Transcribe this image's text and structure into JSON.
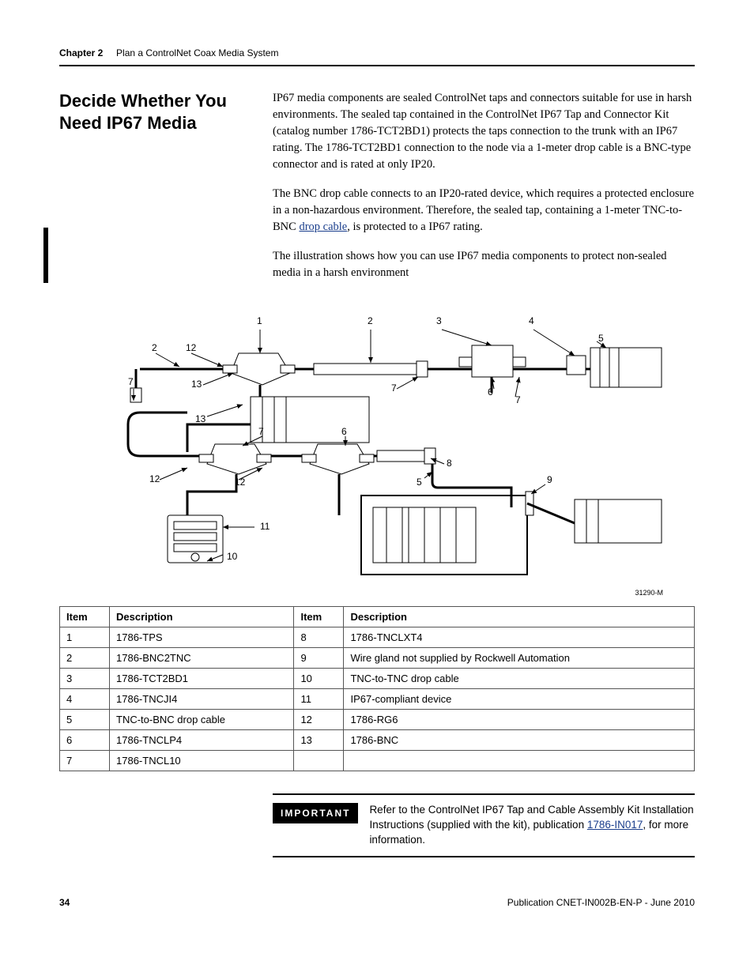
{
  "header": {
    "chapter_label": "Chapter 2",
    "chapter_title": "Plan a ControlNet Coax Media System"
  },
  "section_heading": "Decide Whether You Need IP67 Media",
  "paragraphs": {
    "p1": "IP67 media components are sealed ControlNet taps and connectors suitable for use in harsh environments. The sealed tap contained in the ControlNet IP67 Tap and Connector Kit (catalog number 1786-TCT2BD1) protects the taps connection to the trunk with an IP67 rating. The 1786-TCT2BD1 connection to the node via a 1-meter drop cable is a BNC-type connector and is rated at only IP20.",
    "p2a": "The BNC drop cable connects to an IP20-rated device, which requires a protected enclosure in a non-hazardous environment. Therefore, the sealed tap, containing a 1-meter TNC-to-BNC ",
    "p2_link": "drop cable",
    "p2b": ", is protected to a IP67 rating.",
    "p3": "The illustration shows how you can use IP67 media components to protect non-sealed media in a harsh environment"
  },
  "diagram": {
    "labels": {
      "n1": "1",
      "n2": "2",
      "n3": "3",
      "n4": "4",
      "n5": "5",
      "n6": "6",
      "n7": "7",
      "n8": "8",
      "n9": "9",
      "n10": "10",
      "n11": "11",
      "n12": "12",
      "n13": "13"
    },
    "fig_code": "31290-M"
  },
  "table": {
    "headers": {
      "item": "Item",
      "desc": "Description"
    },
    "left": [
      {
        "item": "1",
        "desc": "1786-TPS"
      },
      {
        "item": "2",
        "desc": "1786-BNC2TNC"
      },
      {
        "item": "3",
        "desc": "1786-TCT2BD1"
      },
      {
        "item": "4",
        "desc": "1786-TNCJI4"
      },
      {
        "item": "5",
        "desc": "TNC-to-BNC drop cable"
      },
      {
        "item": "6",
        "desc": "1786-TNCLP4"
      },
      {
        "item": "7",
        "desc": "1786-TNCL10"
      }
    ],
    "right": [
      {
        "item": "8",
        "desc": "1786-TNCLXT4"
      },
      {
        "item": "9",
        "desc": "Wire gland not supplied by Rockwell Automation"
      },
      {
        "item": "10",
        "desc": "TNC-to-TNC drop cable"
      },
      {
        "item": "11",
        "desc": "IP67-compliant device"
      },
      {
        "item": "12",
        "desc": "1786-RG6"
      },
      {
        "item": "13",
        "desc": "1786-BNC"
      },
      {
        "item": "",
        "desc": ""
      }
    ]
  },
  "important": {
    "tag": "IMPORTANT",
    "text_a": "Refer to the ControlNet IP67 Tap and Cable Assembly Kit Installation Instructions (supplied with the kit), publication ",
    "link": "1786-IN017",
    "text_b": ", for more information."
  },
  "footer": {
    "page": "34",
    "pub": "Publication CNET-IN002B-EN-P - June 2010"
  }
}
